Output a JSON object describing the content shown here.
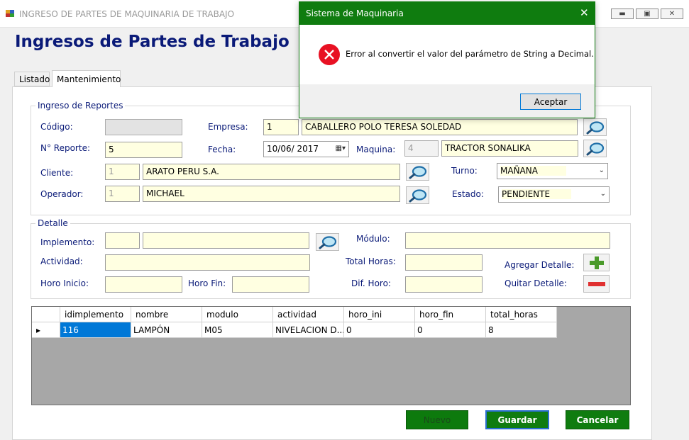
{
  "window": {
    "title": "INGRESO DE PARTES DE MAQUINARIA DE TRABAJO",
    "header": "Ingresos de Partes de Trabajo"
  },
  "tabs": [
    {
      "label": "Listado",
      "active": false
    },
    {
      "label": "Mantenimiento",
      "active": true
    }
  ],
  "reportes": {
    "group_label": "Ingreso de Reportes",
    "codigo_label": "Código:",
    "codigo_value": "",
    "empresa_label": "Empresa:",
    "empresa_id": "1",
    "empresa_name": "CABALLERO POLO TERESA SOLEDAD",
    "reporte_label": "N° Reporte:",
    "reporte_value": "5",
    "fecha_label": "Fecha:",
    "fecha_value": "10/06/ 2017",
    "maquina_label": "Maquina:",
    "maquina_id": "4",
    "maquina_name": "TRACTOR SONALIKA",
    "cliente_label": "Cliente:",
    "cliente_id": "1",
    "cliente_name": "ARATO PERU S.A.",
    "turno_label": "Turno:",
    "turno_value": "MAÑANA",
    "operador_label": "Operador:",
    "operador_id": "1",
    "operador_name": "MICHAEL",
    "estado_label": "Estado:",
    "estado_value": "PENDIENTE"
  },
  "detalle": {
    "group_label": "Detalle",
    "implemento_label": "Implemento:",
    "modulo_label": "Módulo:",
    "actividad_label": "Actividad:",
    "total_horas_label": "Total Horas:",
    "agregar_label": "Agregar Detalle:",
    "horo_inicio_label": "Horo Inicio:",
    "horo_fin_label": "Horo Fin:",
    "dif_horo_label": "Dif. Horo:",
    "quitar_label": "Quitar Detalle:"
  },
  "grid": {
    "columns": [
      "idimplemento",
      "nombre",
      "modulo",
      "actividad",
      "horo_ini",
      "horo_fin",
      "total_horas"
    ],
    "rows": [
      [
        "116",
        "LAMPÓN",
        "M05",
        "NIVELACION D...",
        "0",
        "0",
        "8"
      ]
    ]
  },
  "buttons": {
    "nuevo": "Nuevo",
    "guardar": "Guardar",
    "cancelar": "Cancelar"
  },
  "dialog": {
    "title": "Sistema de Maquinaria",
    "message": "Error al convertir el valor del parámetro de String a Decimal.",
    "ok": "Aceptar"
  },
  "colors": {
    "accent_green": "#0f7c0f",
    "header_navy": "#0a1a78",
    "field_yellow": "#ffffe1",
    "selection_blue": "#0078d7",
    "error_red": "#e81123"
  },
  "icons": [
    "app-icon",
    "minimize-icon",
    "maximize-icon",
    "close-icon",
    "magnifier-icon",
    "calendar-icon",
    "chevron-down-icon",
    "plus-icon",
    "minus-icon",
    "error-icon",
    "row-pointer-icon"
  ]
}
